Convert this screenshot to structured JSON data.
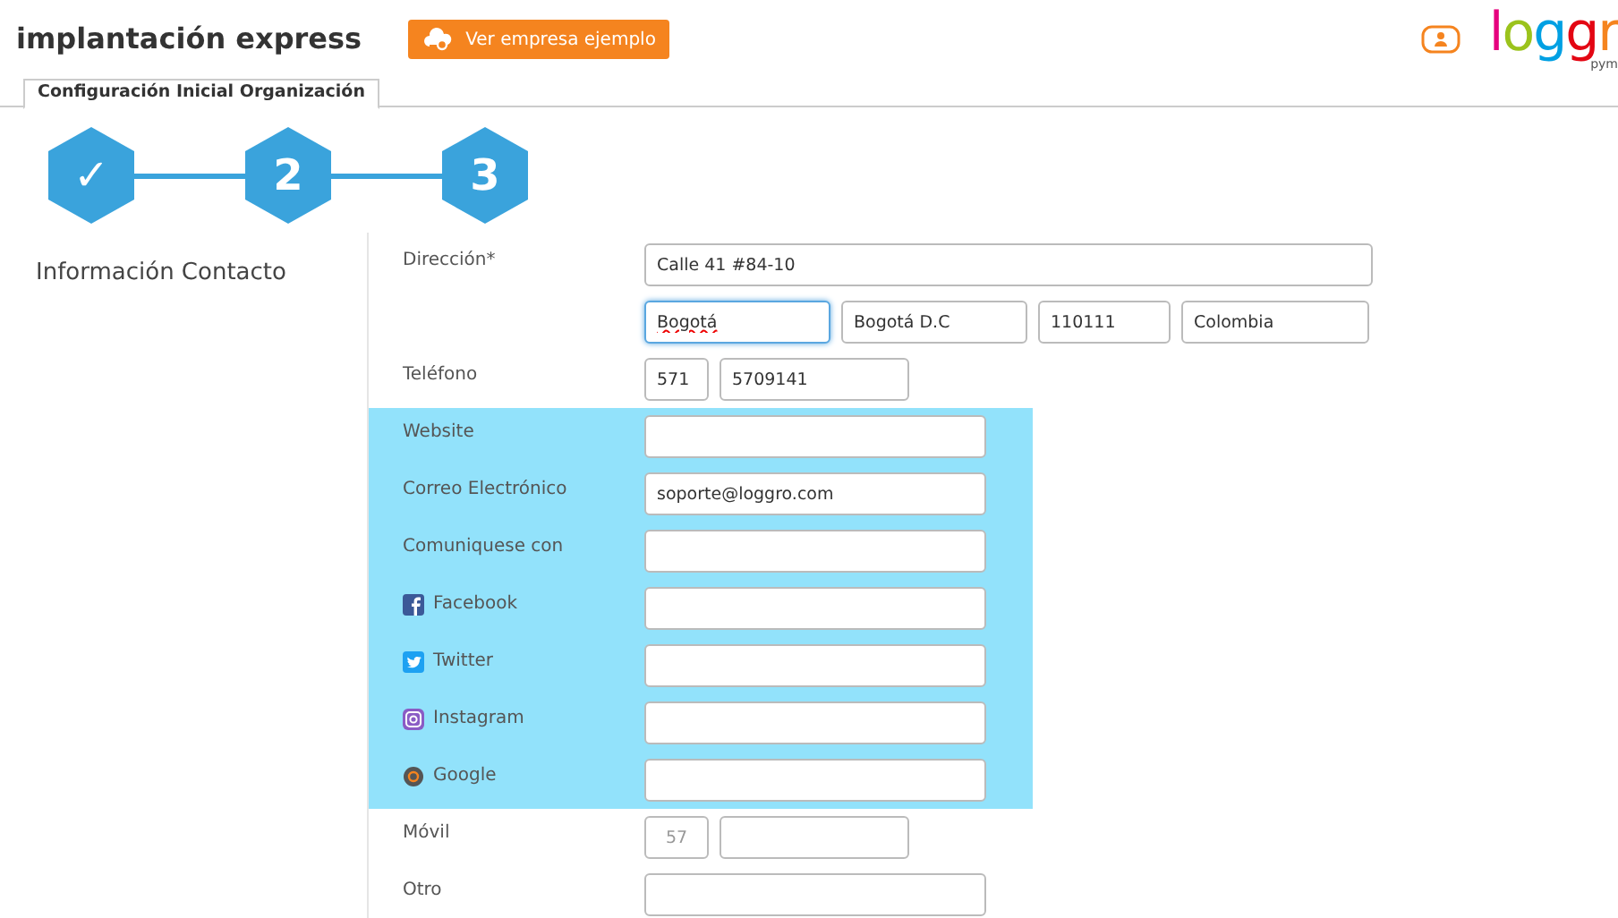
{
  "header": {
    "title": "implantación express",
    "example_button": "Ver empresa ejemplo",
    "logo": "loggr",
    "logo_sub": "pym"
  },
  "tabs": [
    {
      "label": "Configuración Inicial Organización",
      "selected": true
    }
  ],
  "steps": [
    {
      "label": "✓",
      "kind": "done"
    },
    {
      "label": "2",
      "kind": "number"
    },
    {
      "label": "3",
      "kind": "number"
    }
  ],
  "section_title": "Información Contacto",
  "rows": [
    {
      "label": "Dirección*",
      "kind": "wide",
      "highlighted": false,
      "fields": [
        {
          "value": "Calle 41 #84-10"
        }
      ]
    },
    {
      "kind": "address",
      "highlighted": false,
      "fields": [
        {
          "value": "Bogotá",
          "focused": true,
          "misspelled": true
        },
        {
          "value": "Bogotá D.C"
        },
        {
          "value": "110111"
        },
        {
          "value": "Colombia"
        }
      ]
    },
    {
      "label": "Teléfono",
      "kind": "phone",
      "highlighted": false,
      "fields": [
        {
          "value": "571"
        },
        {
          "value": "5709141"
        }
      ]
    },
    {
      "label": "Website",
      "kind": "plain",
      "highlighted": true
    },
    {
      "label": "Correo Electrónico",
      "kind": "plain",
      "highlighted": true,
      "fields": [
        {
          "value": "soporte@loggro.com"
        }
      ]
    },
    {
      "label": "Comuniquese con",
      "kind": "plain",
      "highlighted": true
    },
    {
      "label": "Facebook",
      "kind": "facebook",
      "highlighted": true
    },
    {
      "label": "Twitter",
      "kind": "twitter",
      "highlighted": true
    },
    {
      "label": "Instagram",
      "kind": "instagram",
      "highlighted": true
    },
    {
      "label": "Google",
      "kind": "google",
      "highlighted": true
    },
    {
      "label": "Móvil",
      "kind": "phone",
      "highlighted": false,
      "fields": [
        {
          "placeholder": "57"
        }
      ]
    },
    {
      "label": "Otro",
      "kind": "plain",
      "highlighted": false
    }
  ]
}
